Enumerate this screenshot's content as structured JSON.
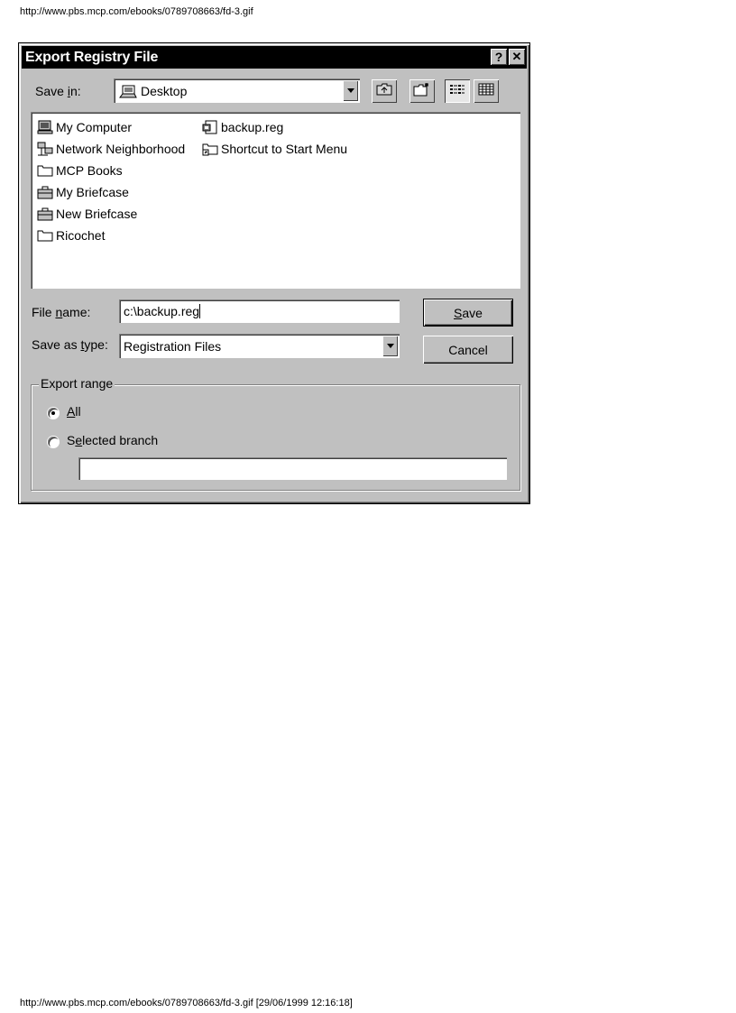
{
  "page": {
    "url": "http://www.pbs.mcp.com/ebooks/0789708663/fd-3.gif",
    "footer": "http://www.pbs.mcp.com/ebooks/0789708663/fd-3.gif [29/06/1999 12:16:18]"
  },
  "dialog": {
    "title": "Export Registry File",
    "help_button": "?",
    "close_button": "✕",
    "save_in": {
      "label_pre": "Save ",
      "label_ul": "i",
      "label_post": "n:",
      "value": "Desktop"
    },
    "files": [
      {
        "name": "My Computer",
        "icon": "computer-icon"
      },
      {
        "name": "Network Neighborhood",
        "icon": "network-icon"
      },
      {
        "name": "MCP Books",
        "icon": "folder-icon"
      },
      {
        "name": "My Briefcase",
        "icon": "briefcase-icon"
      },
      {
        "name": "New Briefcase",
        "icon": "briefcase-icon"
      },
      {
        "name": "Ricochet",
        "icon": "folder-icon"
      },
      {
        "name": "backup.reg",
        "icon": "registry-file-icon"
      },
      {
        "name": "Shortcut to Start Menu",
        "icon": "shortcut-folder-icon"
      }
    ],
    "file_name": {
      "label_pre": "File ",
      "label_ul": "n",
      "label_post": "ame:",
      "value": "c:\\backup.reg"
    },
    "save_as_type": {
      "label_pre": "Save as ",
      "label_ul": "t",
      "label_post": "ype:",
      "value": "Registration Files"
    },
    "save_button": {
      "ul": "S",
      "rest": "ave"
    },
    "cancel_button": "Cancel",
    "export_range": {
      "legend": "Export range",
      "all": {
        "ul": "A",
        "rest": "ll"
      },
      "selected": {
        "pre": "S",
        "ul": "e",
        "rest": "lected branch"
      },
      "branch_value": ""
    }
  }
}
